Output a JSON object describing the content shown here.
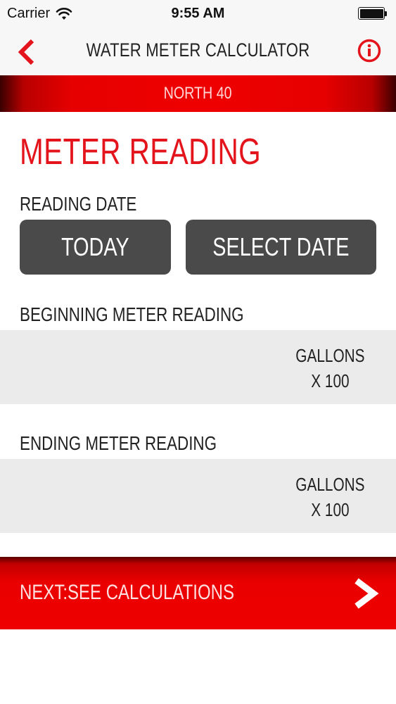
{
  "status_bar": {
    "carrier": "Carrier",
    "time": "9:55 AM",
    "battery_level": 1.0
  },
  "nav": {
    "title": "WATER METER CALCULATOR",
    "back_icon": "chevron-left-icon",
    "info_icon": "info-icon"
  },
  "banner": {
    "location": "NORTH 40"
  },
  "main": {
    "section_title": "METER READING",
    "reading_date_label": "READING DATE",
    "today_button": "TODAY",
    "select_date_button": "SELECT DATE",
    "beginning_label": "BEGINNING METER READING",
    "beginning_value": "",
    "beginning_unit_line1": "GALLONS",
    "beginning_unit_line2": "X 100",
    "ending_label": "ENDING METER READING",
    "ending_value": "",
    "ending_unit_line1": "GALLONS",
    "ending_unit_line2": "X 100"
  },
  "footer": {
    "next_label": "NEXT:SEE CALCULATIONS",
    "next_icon": "chevron-right-icon"
  },
  "colors": {
    "accent": "#e3141b",
    "button_gray": "#4a4a4a",
    "field_bg": "#ebebeb"
  }
}
